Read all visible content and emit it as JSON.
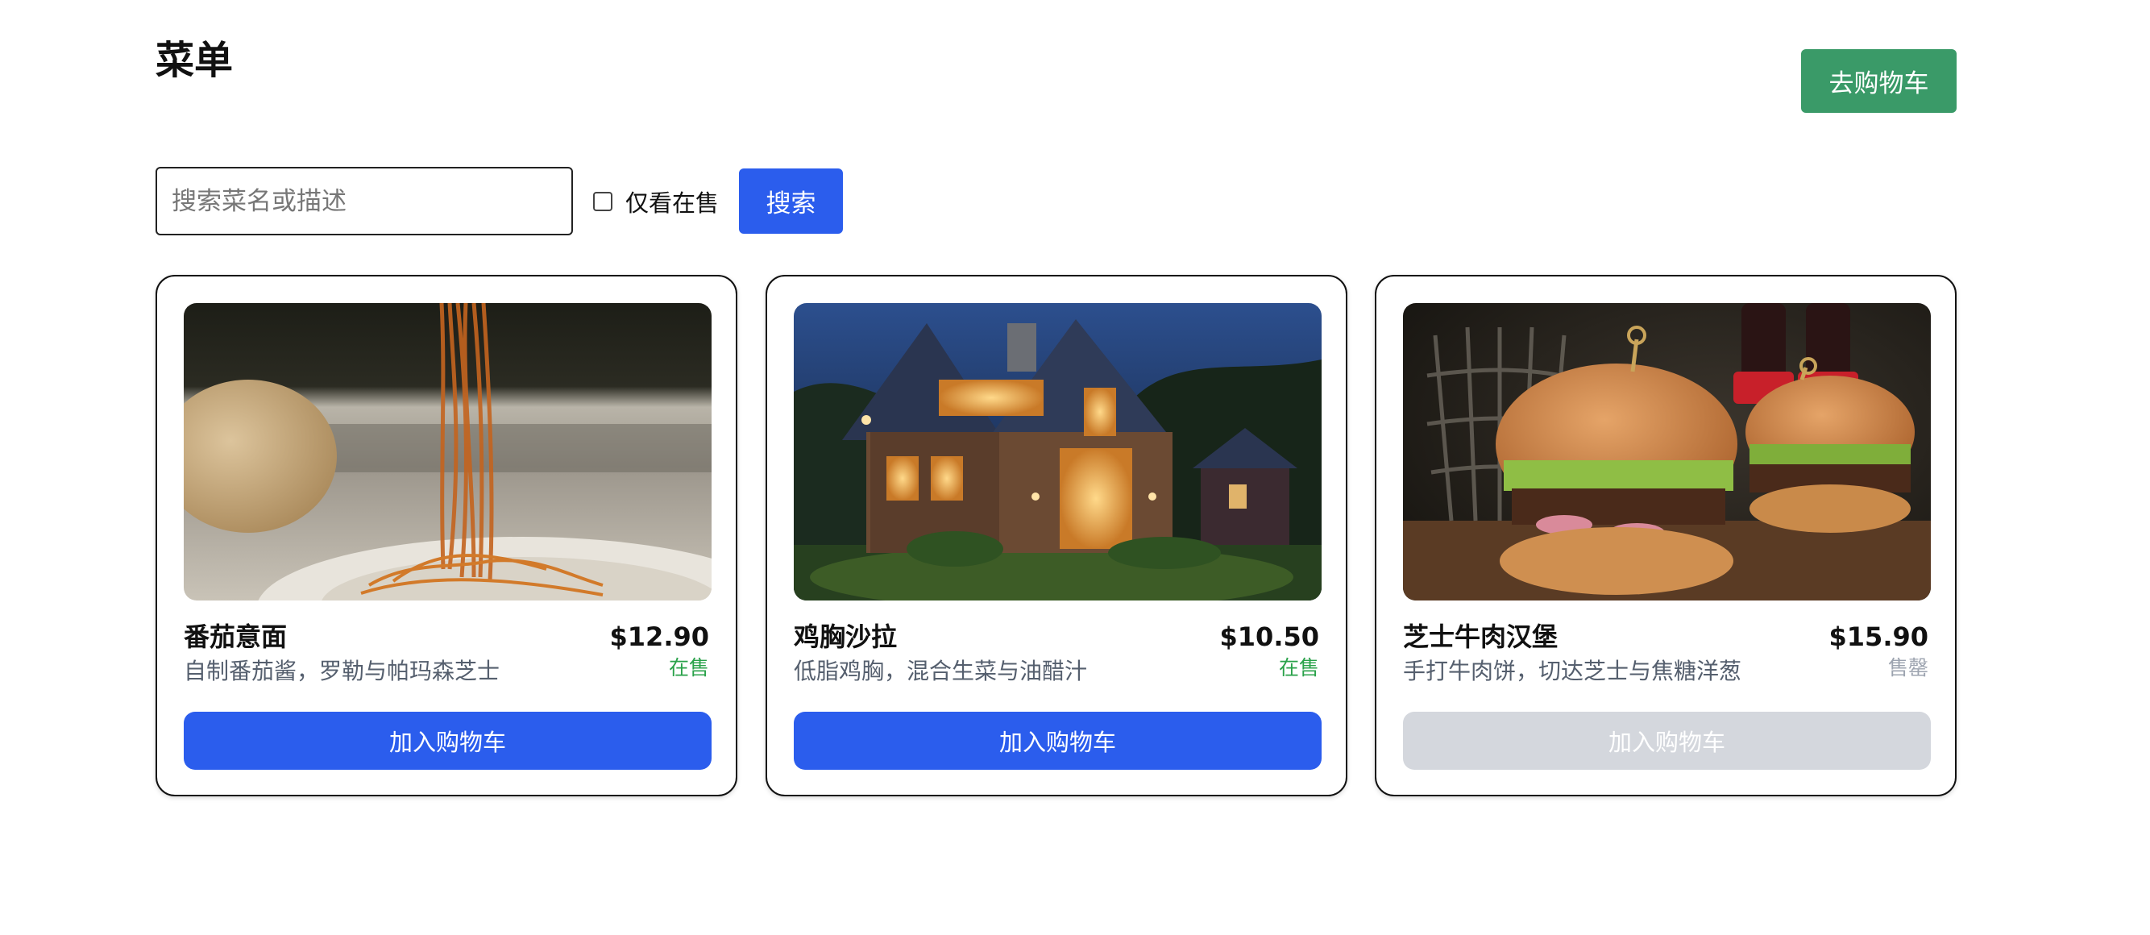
{
  "header": {
    "title": "菜单",
    "cart_button": "去购物车"
  },
  "search": {
    "placeholder": "搜索菜名或描述",
    "value": "",
    "only_on_sale_label": "仅看在售",
    "only_on_sale_checked": false,
    "search_button": "搜索"
  },
  "menu": {
    "items": [
      {
        "name": "番茄意面",
        "price": "$12.90",
        "description": "自制番茄酱，罗勒与帕玛森芝士",
        "status": "在售",
        "available": true,
        "button": "加入购物车",
        "image_icon": "pasta-photo"
      },
      {
        "name": "鸡胸沙拉",
        "price": "$10.50",
        "description": "低脂鸡胸，混合生菜与油醋汁",
        "status": "在售",
        "available": true,
        "button": "加入购物车",
        "image_icon": "house-photo"
      },
      {
        "name": "芝士牛肉汉堡",
        "price": "$15.90",
        "description": "手打牛肉饼，切达芝士与焦糖洋葱",
        "status": "售罄",
        "available": false,
        "button": "加入购物车",
        "image_icon": "burger-photo"
      }
    ]
  },
  "colors": {
    "primary": "#2b5ded",
    "cart_button": "#3a9a68",
    "on_sale": "#2aa24a",
    "sold_out": "#9ca3af",
    "disabled_button": "#d4d7dd"
  }
}
